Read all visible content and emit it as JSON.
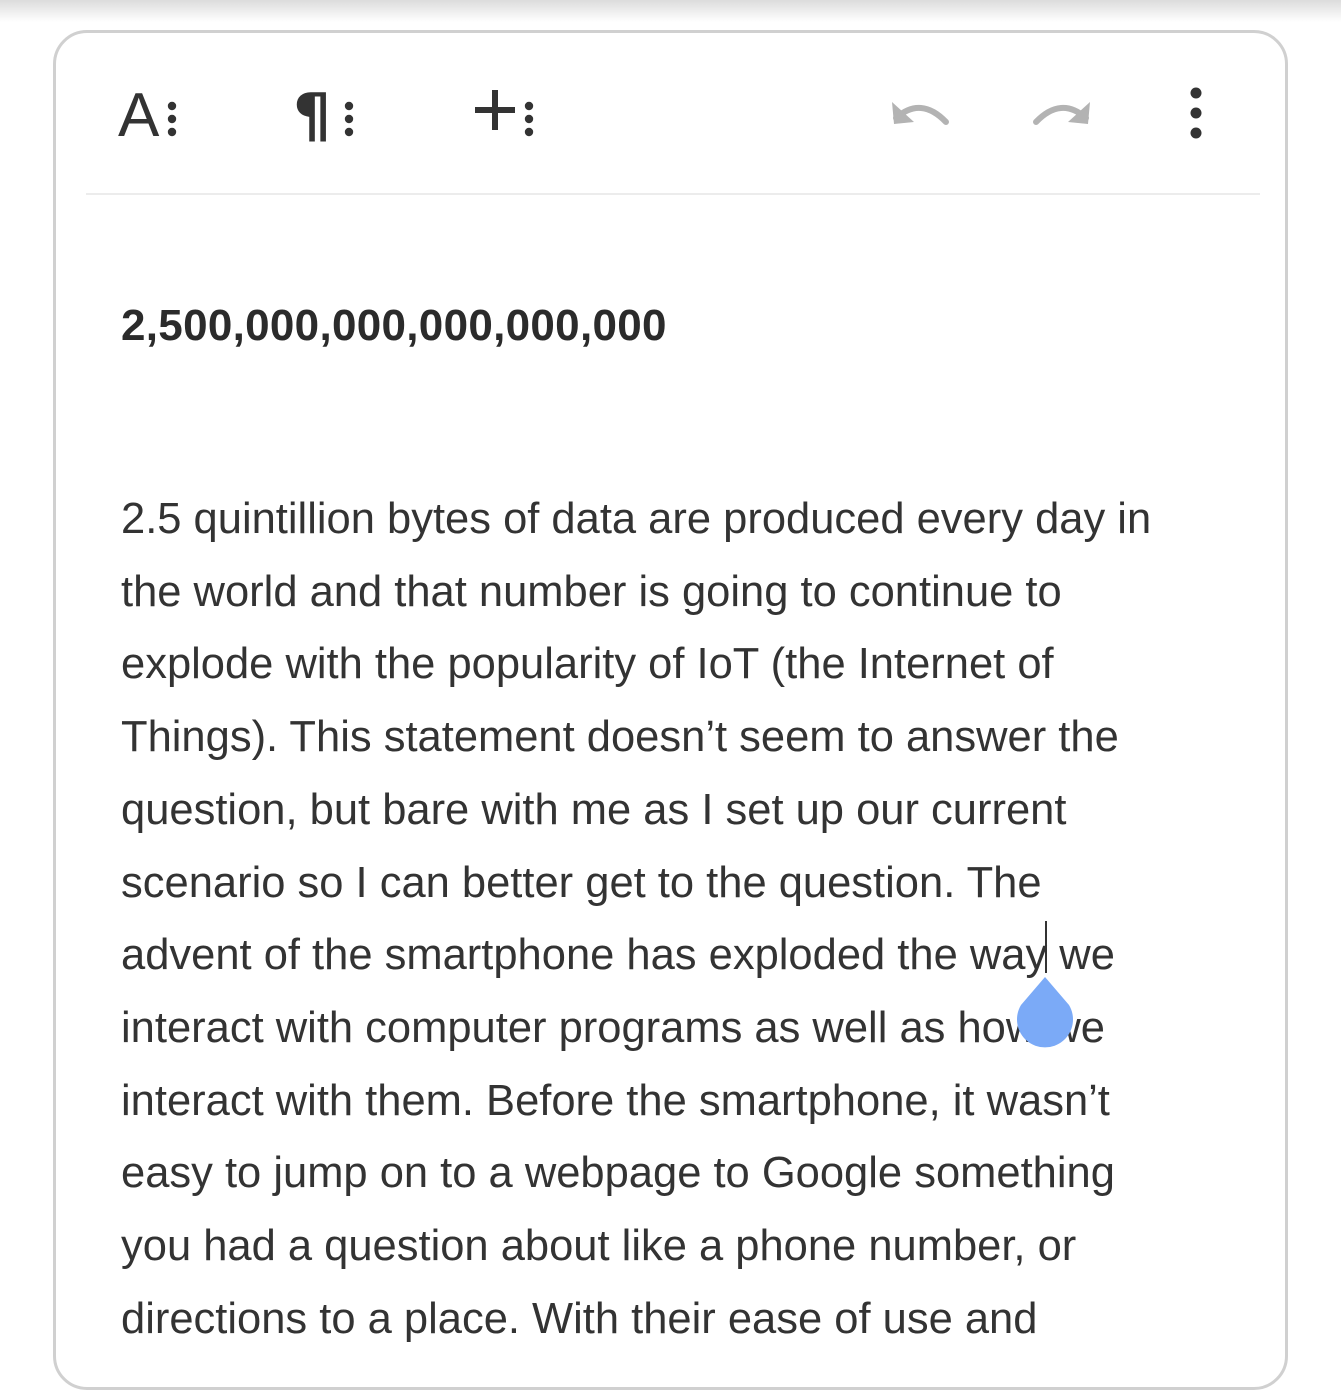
{
  "toolbar": {
    "text_format_icon": "text-format-icon",
    "paragraph_format_icon": "paragraph-format-icon",
    "insert_icon": "insert-icon",
    "undo_icon": "undo-icon",
    "redo_icon": "redo-icon",
    "more_icon": "more-options-icon"
  },
  "document": {
    "heading": "2,500,000,000,000,000,000",
    "paragraph_lines": [
      "2.5 quintillion bytes of data are produced every day in",
      "the world and that number is going to continue to",
      "explode with the popularity of IoT (the Internet of",
      "Things). This statement doesn’t seem to answer the",
      "question, but bare with me as I set up our current",
      "scenario so I can better get to the question. The",
      "advent of the smartphone has exploded the way we",
      "interact with computer programs as well as how we",
      "interact with them. Before the smartphone, it wasn’t",
      "easy to jump on to a webpage to Google something",
      "you had a question about like a phone number, or",
      "directions to a place. With their ease of use and"
    ]
  },
  "colors": {
    "icon_dark": "#333333",
    "icon_disabled": "#b3b3b3",
    "handle": "#7baaf7",
    "border": "#d0d0d0"
  }
}
